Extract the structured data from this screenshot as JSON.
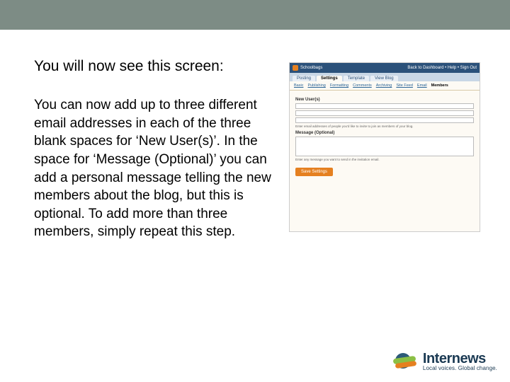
{
  "heading": "You will now see this screen:",
  "body": "You can now add up to three different email addresses in each of the three blank spaces for ‘New User(s)’. In the space for ‘Message (Optional)’ you can add a personal message telling the new members about the blog, but this is optional. To add more than three members, simply repeat this step.",
  "screenshot": {
    "brand": "Schoolbags",
    "top_right": "Back to Dashboard  •  Help  •  Sign Out",
    "tabs1": [
      "Posting",
      "Settings",
      "Template",
      "View Blog"
    ],
    "tabs1_active": 1,
    "tabs2": [
      "Basic",
      "Publishing",
      "Formatting",
      "Comments",
      "Archiving",
      "Site Feed",
      "Email",
      "Members"
    ],
    "tabs2_active": 7,
    "label_new": "New User(s)",
    "hint_new": "Enter email addresses of people you'd like to invite to join as members of your blog.",
    "label_msg": "Message (Optional)",
    "hint_msg": "Enter any message you want to send in the invitation email.",
    "button": "Save Settings"
  },
  "footer": {
    "name": "Internews",
    "tagline": "Local voices. Global change."
  }
}
